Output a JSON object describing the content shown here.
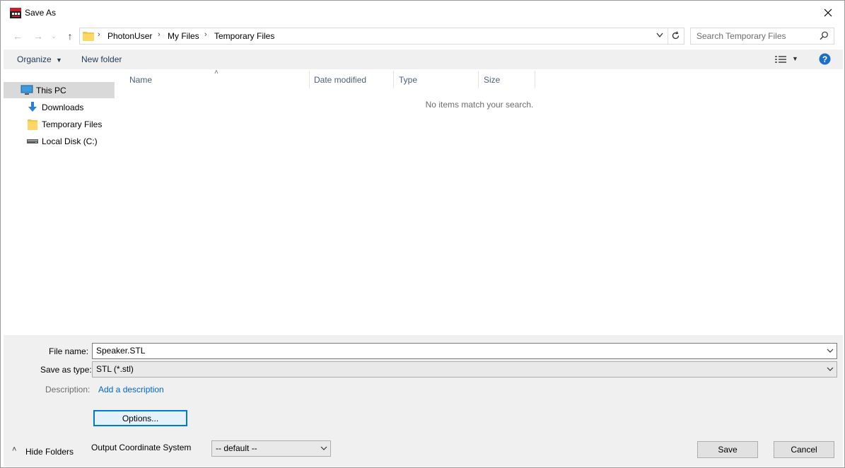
{
  "window": {
    "title": "Save As"
  },
  "address_bar": {
    "breadcrumbs": [
      "PhotonUser",
      "My Files",
      "Temporary Files"
    ]
  },
  "search": {
    "placeholder": "Search Temporary Files"
  },
  "toolbar": {
    "organize_label": "Organize",
    "new_folder_label": "New folder"
  },
  "sidebar": {
    "items": [
      {
        "label": "This PC",
        "icon": "monitor-icon"
      },
      {
        "label": "Downloads",
        "icon": "download-arrow-icon"
      },
      {
        "label": "Temporary Files",
        "icon": "folder-icon"
      },
      {
        "label": "Local Disk (C:)",
        "icon": "drive-icon"
      }
    ]
  },
  "file_list": {
    "columns": [
      "Name",
      "Date modified",
      "Type",
      "Size"
    ],
    "empty_message": "No items match your search."
  },
  "form": {
    "file_name_label": "File name:",
    "file_name_value": "Speaker.STL",
    "save_type_label": "Save as type:",
    "save_type_value": "STL (*.stl)",
    "description_label": "Description:",
    "description_link": "Add a description",
    "options_label": "Options...",
    "hide_folders_label": "Hide Folders",
    "output_coord_label": "Output Coordinate System",
    "output_coord_value": "-- default --",
    "save_label": "Save",
    "cancel_label": "Cancel"
  },
  "colors": {
    "accent": "#0078d7",
    "panel_bg": "#f0f0f0",
    "help_icon": "#1a6fc9",
    "folder_yellow": "#f4c54a"
  }
}
